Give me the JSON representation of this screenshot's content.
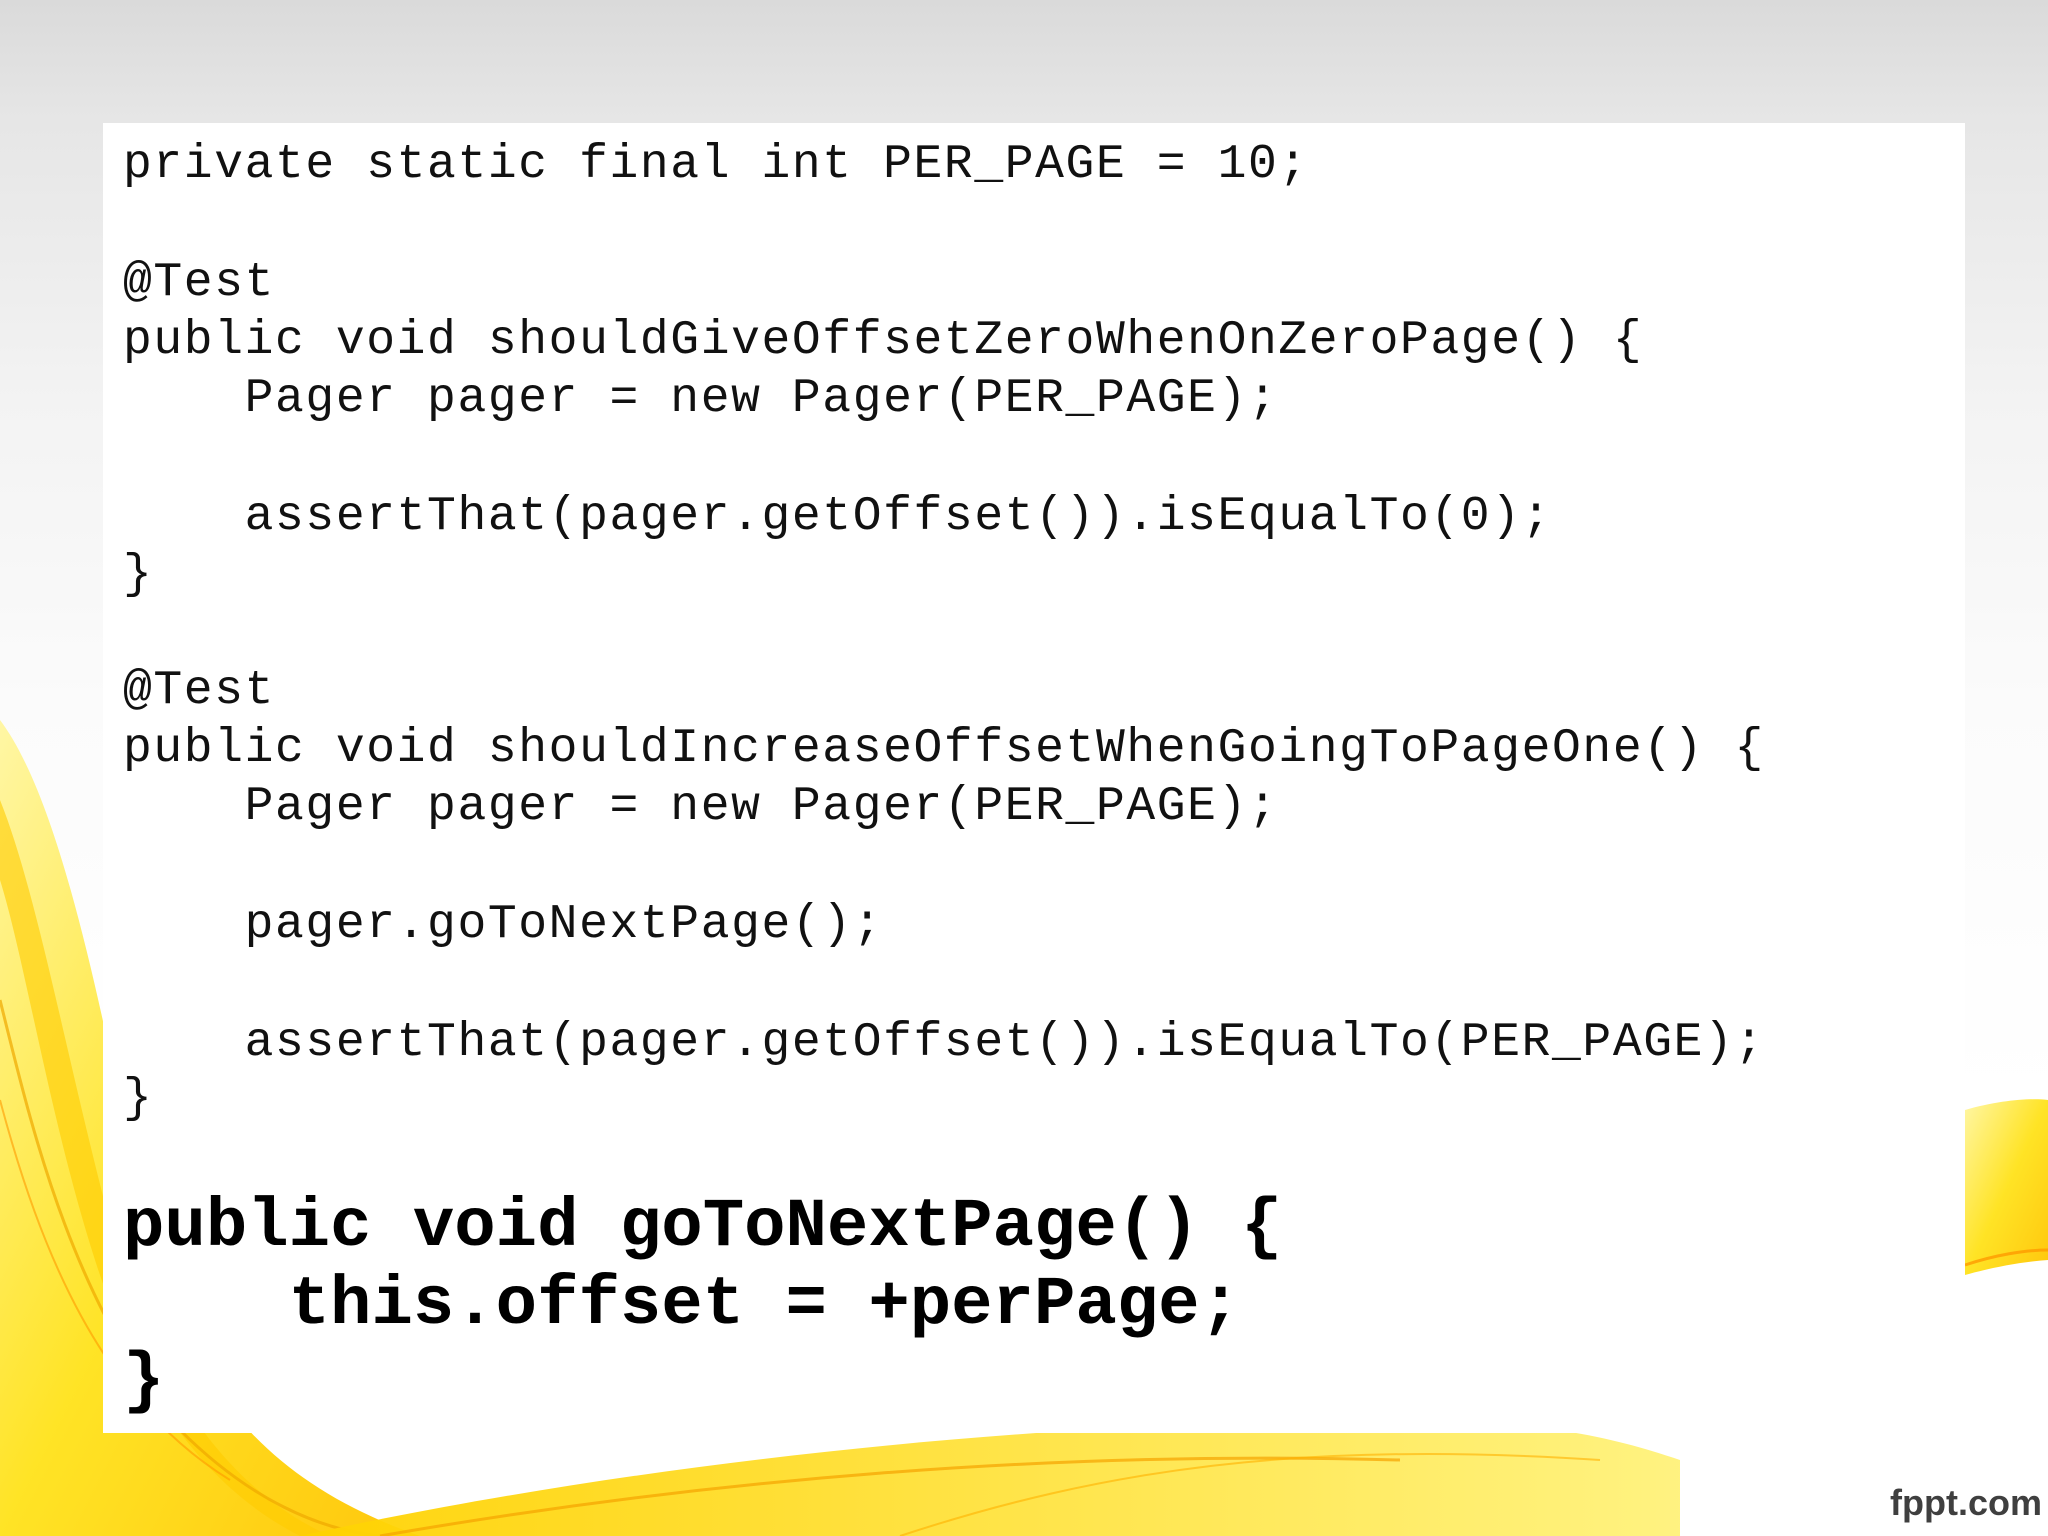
{
  "slide": {
    "colors": {
      "background_top": "#dadada",
      "background_bottom": "#ffffff",
      "accent_yellow": "#ffd800",
      "accent_orange": "#ffb800",
      "code_text": "#111111"
    },
    "code_lines": [
      "private static final int PER_PAGE = 10;",
      "@Test",
      "public void shouldGiveOffsetZeroWhenOnZeroPage() {",
      "    Pager pager = new Pager(PER_PAGE);",
      "    assertThat(pager.getOffset()).isEqualTo(0);",
      "}",
      "@Test",
      "public void shouldIncreaseOffsetWhenGoingToPageOne() {",
      "    Pager pager = new Pager(PER_PAGE);",
      "    pager.goToNextPage();",
      "    assertThat(pager.getOffset()).isEqualTo(PER_PAGE);",
      "}"
    ],
    "highlight_lines": [
      "public void goToNextPage() {",
      "    this.offset = +perPage;",
      "}"
    ],
    "watermark": "fppt.com"
  }
}
